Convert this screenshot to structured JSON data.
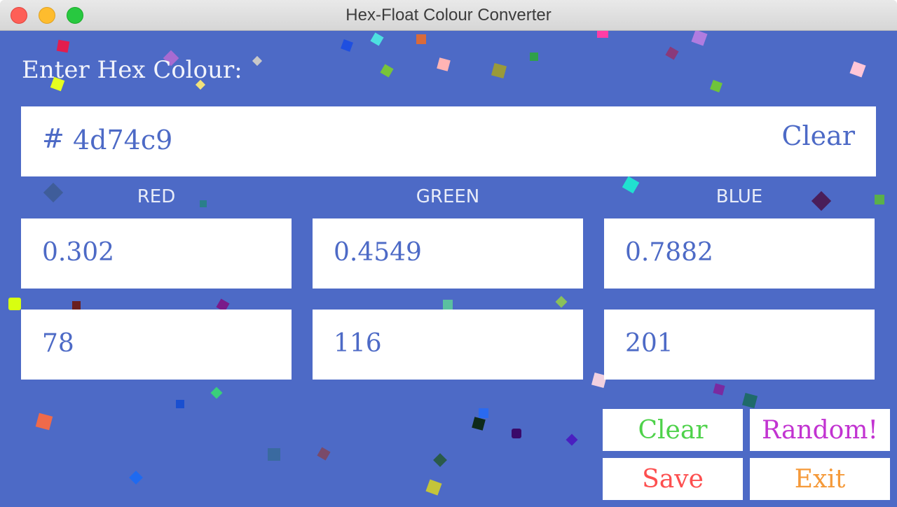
{
  "window": {
    "title": "Hex-Float Colour Converter"
  },
  "colors": {
    "background": "#4d6ac6",
    "clear_button": "#4ed24a",
    "random_button": "#c233d1",
    "save_button": "#fd4f4f",
    "exit_button": "#f59a3a"
  },
  "hex_input": {
    "label": "Enter Hex Colour:",
    "prefix": "#",
    "value": "4d74c9",
    "clear_label": "Clear"
  },
  "channels": [
    {
      "label": "RED",
      "float": "0.302",
      "int": "78"
    },
    {
      "label": "GREEN",
      "float": "0.4549",
      "int": "116"
    },
    {
      "label": "BLUE",
      "float": "0.7882",
      "int": "201"
    }
  ],
  "buttons": {
    "clear": "Clear",
    "random": "Random!",
    "save": "Save",
    "exit": "Exit"
  }
}
